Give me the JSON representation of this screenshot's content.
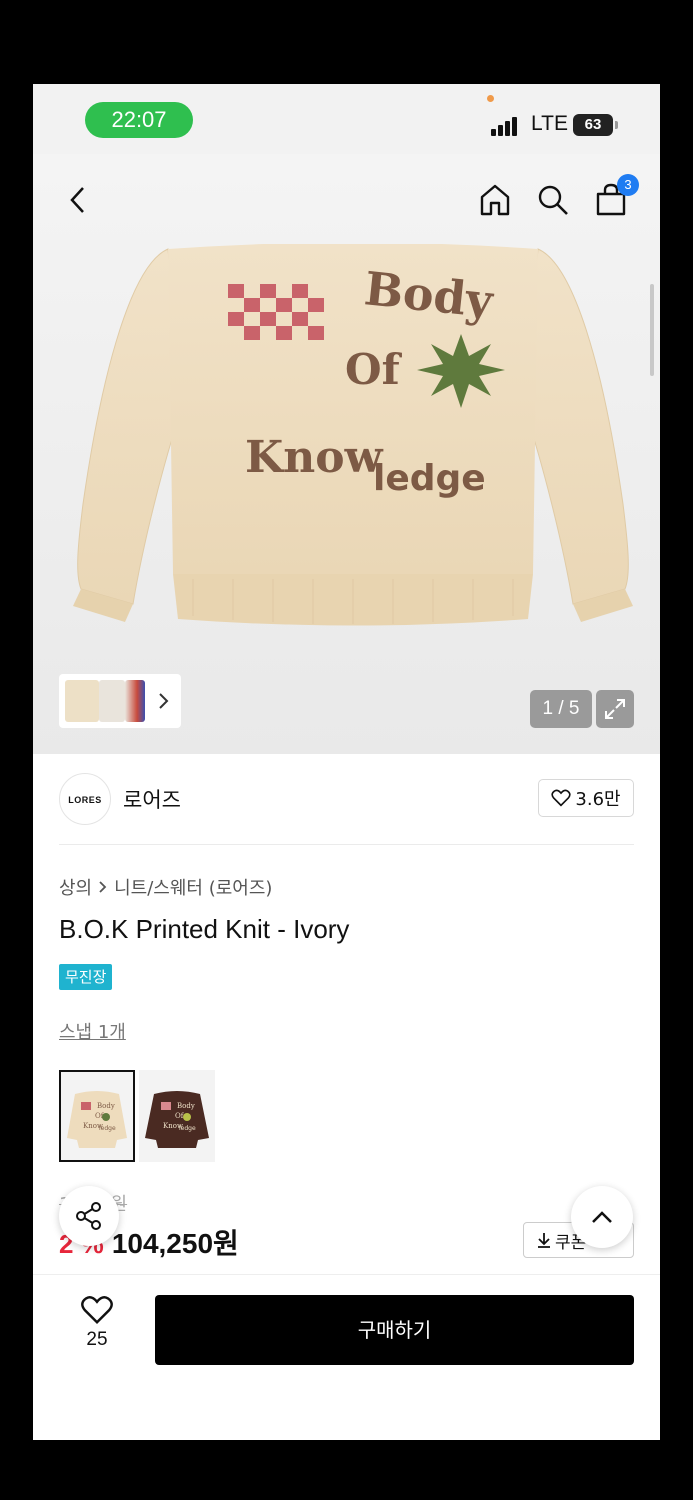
{
  "status_bar": {
    "time": "22:07",
    "network": "LTE",
    "battery": "63"
  },
  "header": {
    "cart_count": "3",
    "icons": [
      "back-icon",
      "home-icon",
      "search-icon",
      "cart-icon"
    ]
  },
  "gallery": {
    "image_counter": "1 / 5",
    "main_image_text": [
      "Body",
      "Of",
      "Know",
      "ledge"
    ],
    "thumb_icon": "chevron-right-icon"
  },
  "brand": {
    "logo_text": "LORES",
    "name": "로어즈",
    "like_count": "3.6만"
  },
  "product": {
    "breadcrumb": [
      "상의",
      "니트/스웨터 (로어즈)"
    ],
    "name": "B.O.K Printed Knit - Ivory",
    "badge": "무진장",
    "snap_link": "스냅 1개",
    "options": [
      {
        "color": "ivory",
        "selected": true,
        "text": [
          "Body",
          "Of",
          "Know",
          "ledge"
        ]
      },
      {
        "color": "brown",
        "selected": false,
        "text": [
          "Body",
          "Of",
          "Know",
          "ledge"
        ]
      }
    ],
    "price_original": "1   ,   00원",
    "discount": "2   %",
    "price": "104,250원",
    "coupon_label": "쿠폰"
  },
  "bottom_bar": {
    "wish_count": "25",
    "buy_label": "구매하기"
  },
  "colors": {
    "accent_green": "#2fbf4f",
    "badge_blue": "#1f7cf2",
    "discount_red": "#e7263b",
    "tag_cyan": "#1fb3cf"
  }
}
